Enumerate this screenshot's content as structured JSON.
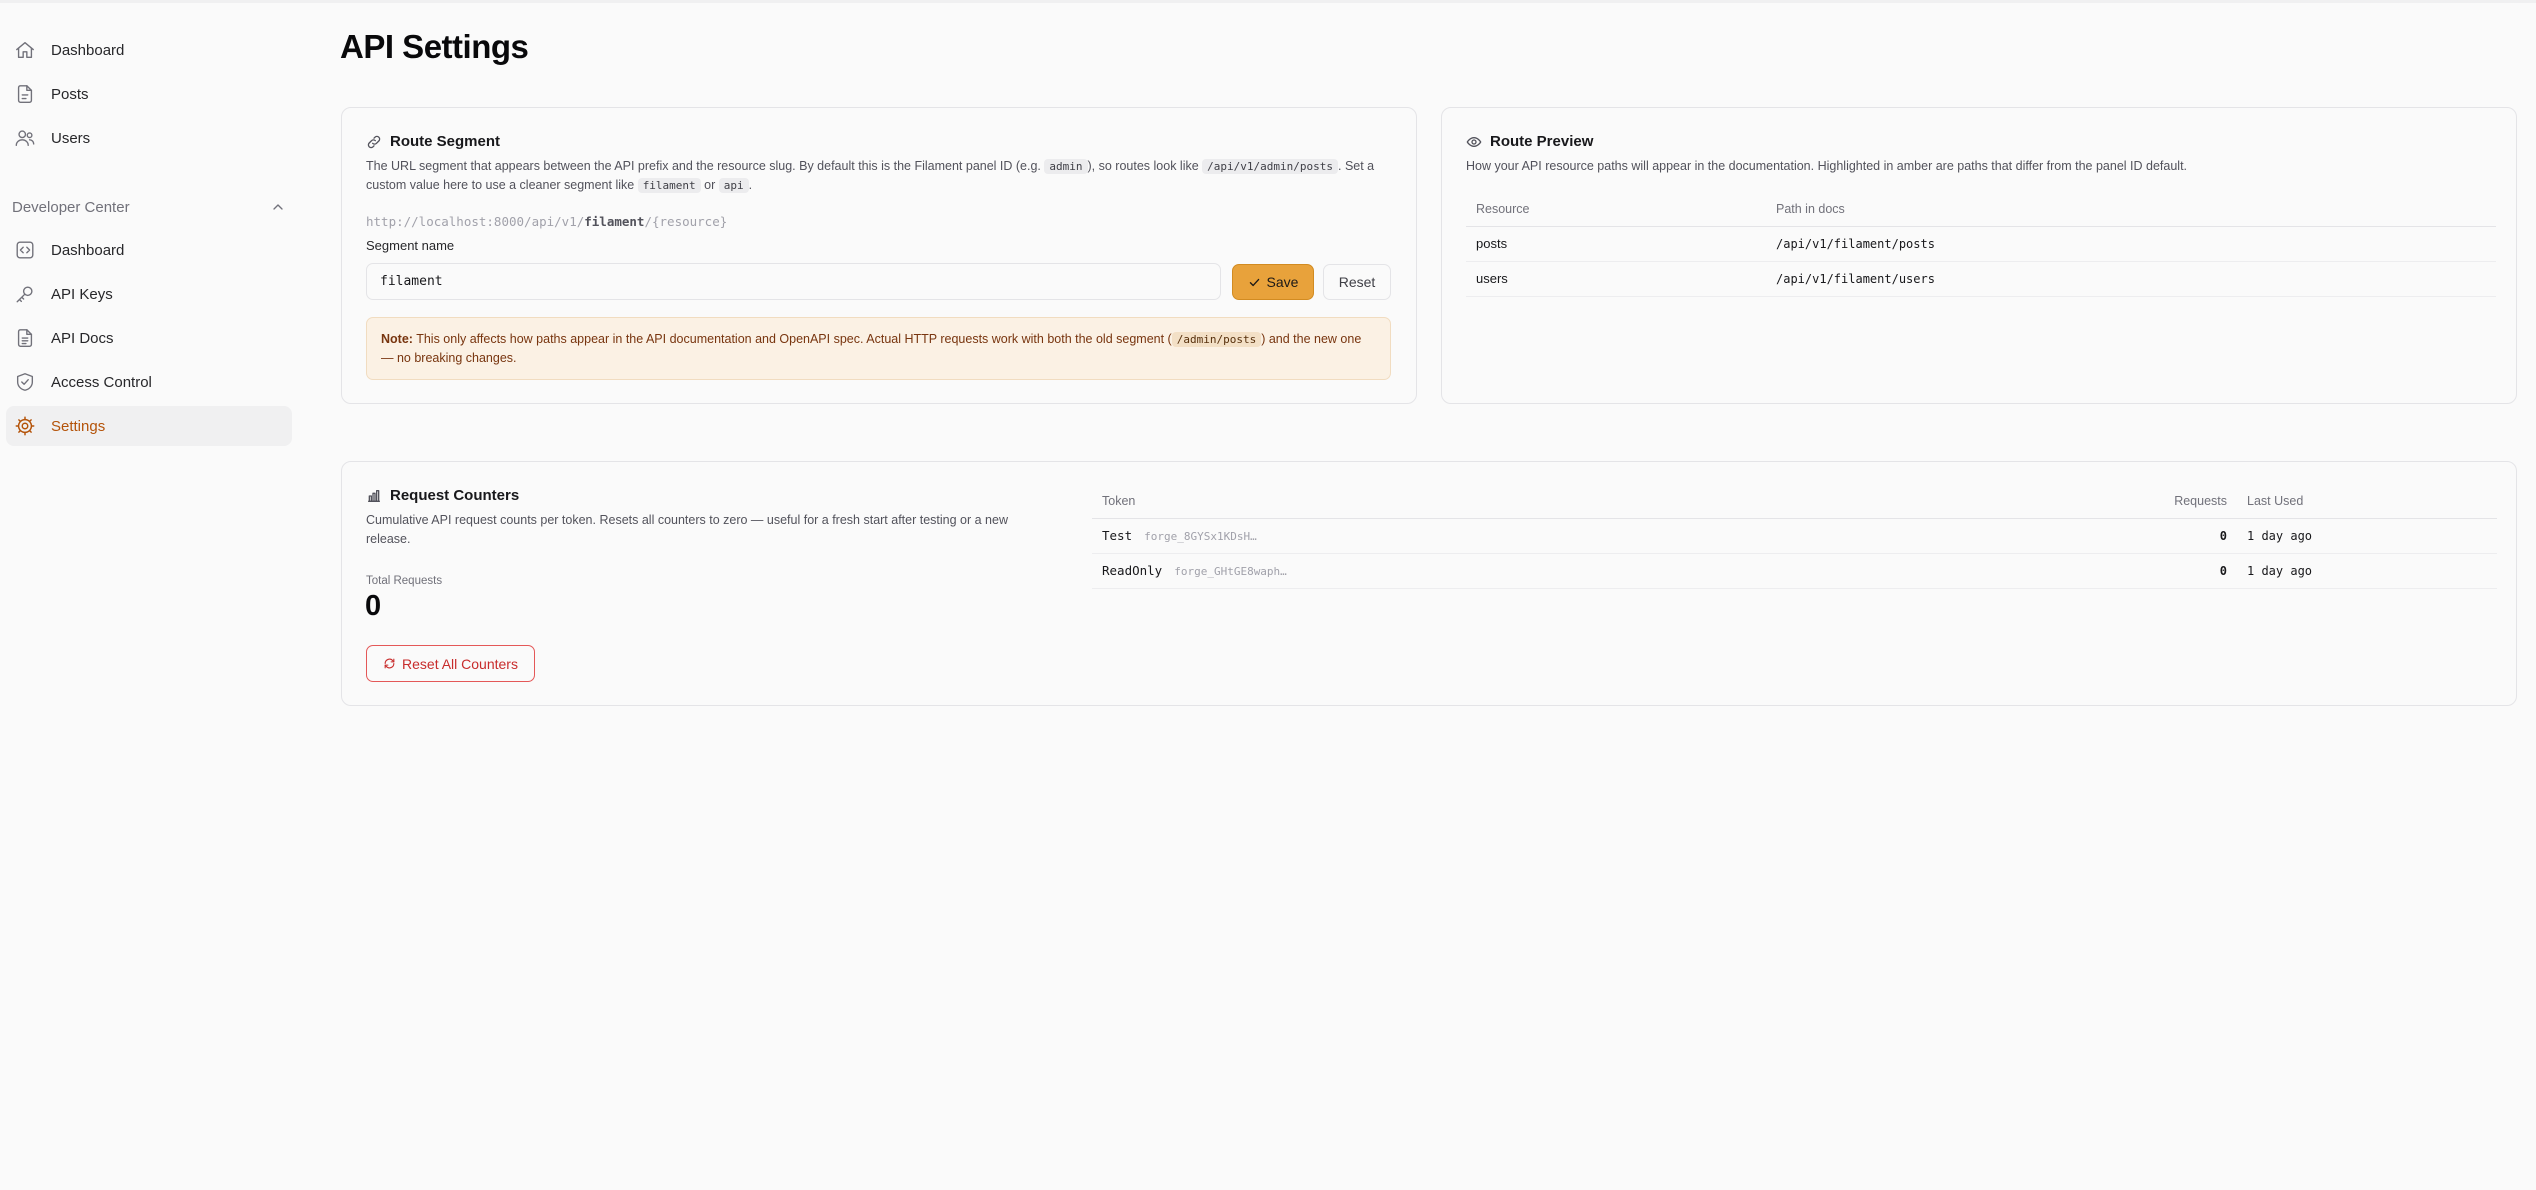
{
  "sidebar": {
    "items": [
      {
        "label": "Dashboard",
        "icon": "home-icon"
      },
      {
        "label": "Posts",
        "icon": "document-icon"
      },
      {
        "label": "Users",
        "icon": "users-icon"
      }
    ],
    "group": {
      "label": "Developer Center",
      "expanded": true,
      "items": [
        {
          "label": "Dashboard",
          "icon": "code-bracket-square-icon"
        },
        {
          "label": "API Keys",
          "icon": "key-icon"
        },
        {
          "label": "API Docs",
          "icon": "document-text-icon"
        },
        {
          "label": "Access Control",
          "icon": "shield-check-icon"
        },
        {
          "label": "Settings",
          "icon": "cog-icon",
          "active": true
        }
      ]
    }
  },
  "page": {
    "title": "API Settings"
  },
  "route_segment": {
    "title": "Route Segment",
    "desc_1": "The URL segment that appears between the API prefix and the resource slug. By default this is the Filament panel ID (e.g. ",
    "desc_code_1": "admin",
    "desc_2": "), so routes look like ",
    "desc_code_2": "/api/v1/admin/posts",
    "desc_3": ". Set a custom value here to use a cleaner segment like ",
    "desc_code_3": "filament",
    "desc_4": " or ",
    "desc_code_4": "api",
    "desc_5": ".",
    "url_prefix": "http://localhost:8000/api/v1/",
    "url_segment": "filament",
    "url_suffix": "/{resource}",
    "field_label": "Segment name",
    "field_value": "filament",
    "save_label": "Save",
    "reset_label": "Reset",
    "note_label": "Note:",
    "note_1": " This only affects how paths appear in the API documentation and OpenAPI spec. Actual HTTP requests work with both the old segment (",
    "note_code": "/admin/posts",
    "note_2": ") and the new one — no breaking changes."
  },
  "route_preview": {
    "title": "Route Preview",
    "desc": "How your API resource paths will appear in the documentation. Highlighted in amber are paths that differ from the panel ID default.",
    "columns": [
      "Resource",
      "Path in docs"
    ],
    "rows": [
      {
        "resource": "posts",
        "path": "/api/v1/filament/posts"
      },
      {
        "resource": "users",
        "path": "/api/v1/filament/users"
      }
    ],
    "highlight_color": "#d97706"
  },
  "request_counters": {
    "title": "Request Counters",
    "desc": "Cumulative API request counts per token. Resets all counters to zero — useful for a fresh start after testing or a new release.",
    "total_label": "Total Requests",
    "total_value": "0",
    "reset_label": "Reset All Counters",
    "columns": [
      "Token",
      "Requests",
      "Last Used"
    ],
    "rows": [
      {
        "name": "Test",
        "prefix": "forge_8GYSx1KDsH…",
        "requests": "0",
        "last_used": "1 day ago"
      },
      {
        "name": "ReadOnly",
        "prefix": "forge_GHtGE8waph…",
        "requests": "0",
        "last_used": "1 day ago"
      }
    ]
  },
  "colors": {
    "accent": "#b45309",
    "primary_button": "#e8a23b",
    "danger": "#c82c2c"
  }
}
